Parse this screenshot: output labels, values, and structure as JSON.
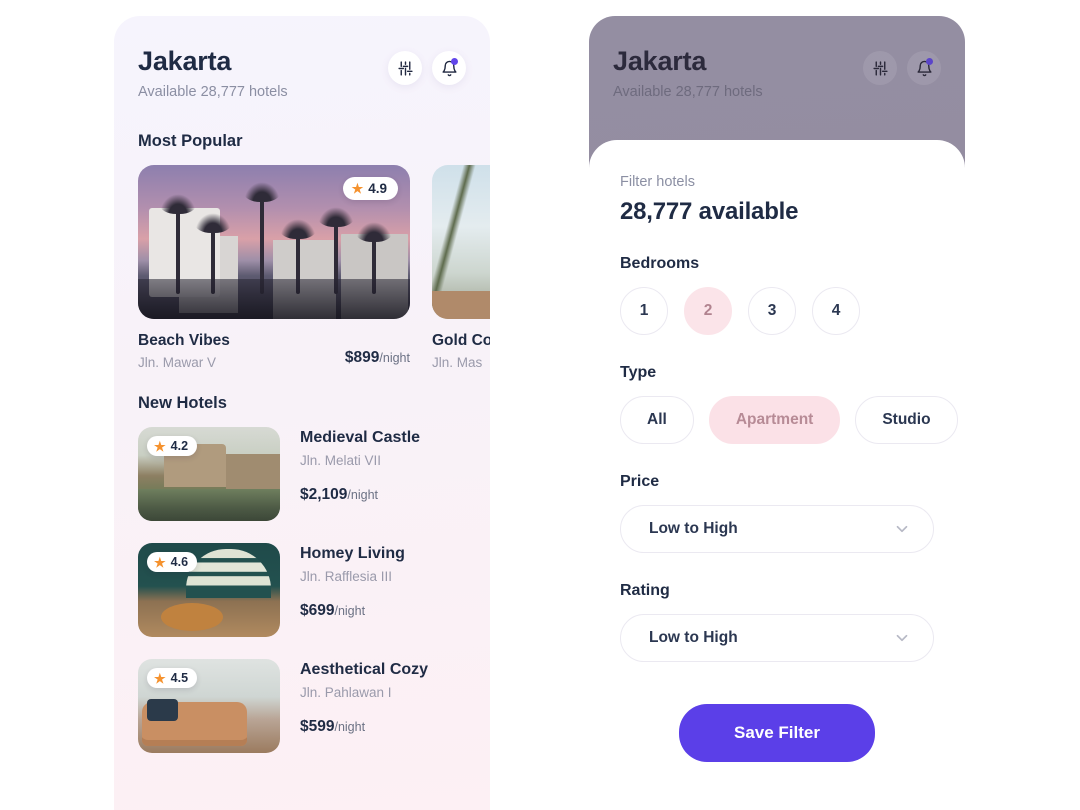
{
  "header": {
    "city": "Jakarta",
    "subtitle": "Available 28,777 hotels",
    "filter_icon": "sliders-icon",
    "bell_icon": "bell-icon"
  },
  "sections": {
    "most_popular": "Most Popular",
    "new_hotels": "New Hotels"
  },
  "popular": [
    {
      "name": "Beach Vibes",
      "address": "Jln. Mawar V",
      "price": "$899",
      "per": "/night",
      "rating": "4.9",
      "photo": "beach-resort-sunset"
    },
    {
      "name": "Gold Co",
      "address": "Jln. Mas",
      "price": "",
      "per": "",
      "rating": "",
      "photo": "palm-trees"
    }
  ],
  "new_hotels": [
    {
      "name": "Medieval Castle",
      "address": "Jln. Melati VII",
      "price": "$2,109",
      "per": "/night",
      "rating": "4.2",
      "photo": "castle-lagoon"
    },
    {
      "name": "Homey Living",
      "address": "Jln. Rafflesia III",
      "price": "$699",
      "per": "/night",
      "rating": "4.6",
      "photo": "living-room-shelves"
    },
    {
      "name": "Aesthetical Cozy",
      "address": "Jln. Pahlawan I",
      "price": "$599",
      "per": "/night",
      "rating": "4.5",
      "photo": "leather-sofa-room"
    }
  ],
  "filter": {
    "label": "Filter hotels",
    "count": "28,777 available",
    "bedrooms": {
      "title": "Bedrooms",
      "options": [
        "1",
        "2",
        "3",
        "4"
      ],
      "selected": "2"
    },
    "type": {
      "title": "Type",
      "options": [
        "All",
        "Apartment",
        "Studio"
      ],
      "selected": "Apartment"
    },
    "price": {
      "title": "Price",
      "value": "Low to High",
      "chevron": "chevron-down-icon"
    },
    "rating": {
      "title": "Rating",
      "value": "Low to High",
      "chevron": "chevron-down-icon"
    },
    "save_label": "Save Filter"
  },
  "colors": {
    "accent_purple": "#5b3fe8",
    "chip_selected_pink": "#fbe1e7",
    "chip_selected_text": "#b78b96",
    "star_orange": "#f5922e",
    "heading_navy": "#1f2b44",
    "muted_gray": "#9a9aab"
  }
}
